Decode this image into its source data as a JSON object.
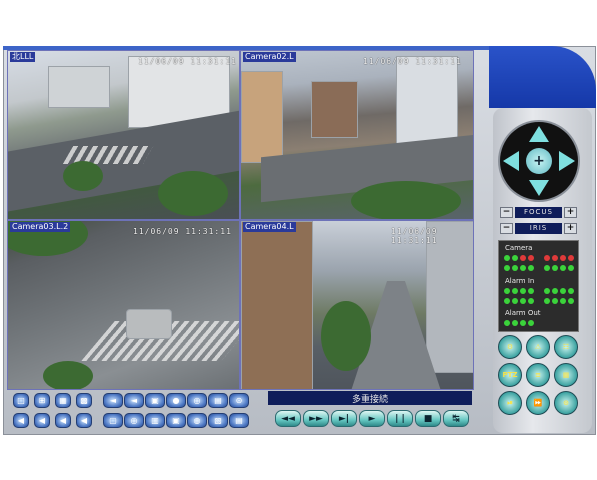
{
  "cameras": [
    {
      "label": "北LLL",
      "timestamp": "11/06/09 11:31:11"
    },
    {
      "label": "Camera02.L",
      "timestamp": "11/06/09 11:31:11"
    },
    {
      "label": "Camera03.L.2",
      "timestamp": "11/06/09 11:31:11"
    },
    {
      "label": "Camera04.L",
      "timestamp": "11/06/09 11:31:11"
    }
  ],
  "ptz": {
    "center_symbol": "+",
    "focus_label": "FOCUS",
    "iris_label": "IRIS",
    "minus": "−",
    "plus": "+"
  },
  "status": {
    "camera_label": "Camera",
    "alarm_in_label": "Alarm In",
    "alarm_out_label": "Alarm Out",
    "camera_leds": [
      "red",
      "red",
      "red",
      "red",
      "red",
      "red",
      "red",
      "red",
      "red",
      "red",
      "red",
      "red",
      "red",
      "red",
      "red",
      "red"
    ],
    "alarm_in_leds": 16,
    "alarm_out_leds": 4
  },
  "function_buttons": [
    "⚙",
    "⚠",
    "☷",
    "PTZ",
    "≡",
    "▦",
    "⏯",
    "⏩",
    "⊙"
  ],
  "connection_status": "多重接続",
  "playback_buttons": [
    "◄◄",
    "►►",
    "►|",
    "►",
    "| |",
    "■",
    "↹"
  ],
  "toolbar_icons": {
    "row1": [
      "□",
      "⊞",
      "▦",
      "▩",
      "◄",
      "◄",
      "▣",
      "●",
      "◎",
      "▤",
      "⊙"
    ],
    "row2": [
      "◀",
      "◀",
      "◀",
      "◀",
      "▢",
      "◎",
      "▥",
      "▣",
      "◍",
      "▧",
      "▤"
    ]
  }
}
